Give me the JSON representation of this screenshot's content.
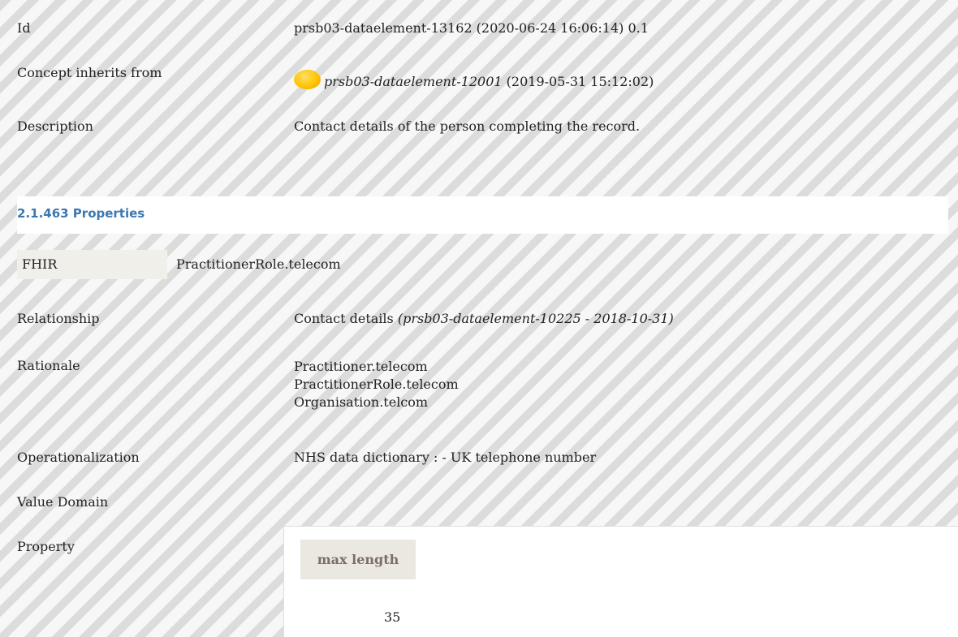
{
  "rows": {
    "id": {
      "label": "Id",
      "value": "prsb03-dataelement-13162 (2020-06-24 16:06:14) 0.1"
    },
    "inherits": {
      "label": "Concept inherits from",
      "link": "prsb03-dataelement-12001",
      "date": " (2019-05-31 15:12:02)"
    },
    "description": {
      "label": "Description",
      "value": "Contact details of the person completing the record."
    }
  },
  "section": {
    "title": "2.1.463 Properties"
  },
  "fhir": {
    "label": "FHIR",
    "value": "PractitionerRole.telecom"
  },
  "relationship": {
    "label": "Relationship",
    "value": "Contact details ",
    "ref": "(prsb03-dataelement-10225 - 2018-10-31)"
  },
  "rationale": {
    "label": "Rationale",
    "lines": [
      "Practitioner.telecom",
      "PractitionerRole.telecom",
      "Organisation.telcom"
    ]
  },
  "operationalization": {
    "label": "Operationalization",
    "value": "NHS data dictionary : - UK telephone number"
  },
  "value_domain": {
    "label": "Value Domain"
  },
  "property": {
    "label": "Property",
    "header": "max length",
    "value": "35"
  },
  "icons": {
    "status": "yellow-status-dot-icon"
  }
}
